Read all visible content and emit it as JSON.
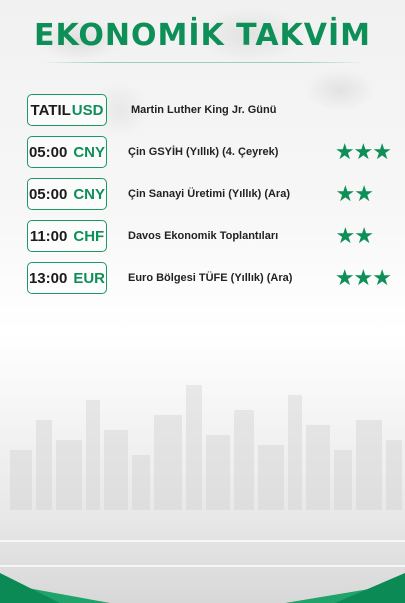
{
  "header": {
    "title": "EKONOMİK TAKVİM"
  },
  "events": [
    {
      "time": "TATIL",
      "currency": "USD",
      "name": "Martin Luther King Jr. Günü",
      "stars": ""
    },
    {
      "time": "05:00",
      "currency": "CNY",
      "name": "Çin GSYİH (Yıllık) (4. Çeyrek)",
      "stars": "★★★"
    },
    {
      "time": "05:00",
      "currency": "CNY",
      "name": "Çin Sanayi Üretimi (Yıllık) (Ara)",
      "stars": "★★"
    },
    {
      "time": "11:00",
      "currency": "CHF",
      "name": "Davos Ekonomik Toplantıları",
      "stars": "★★"
    },
    {
      "time": "13:00",
      "currency": "EUR",
      "name": "Euro Bölgesi TÜFE (Yıllık) (Ara)",
      "stars": "★★★"
    }
  ],
  "colors": {
    "accent": "#0f8f58",
    "border": "#1a9a63"
  }
}
